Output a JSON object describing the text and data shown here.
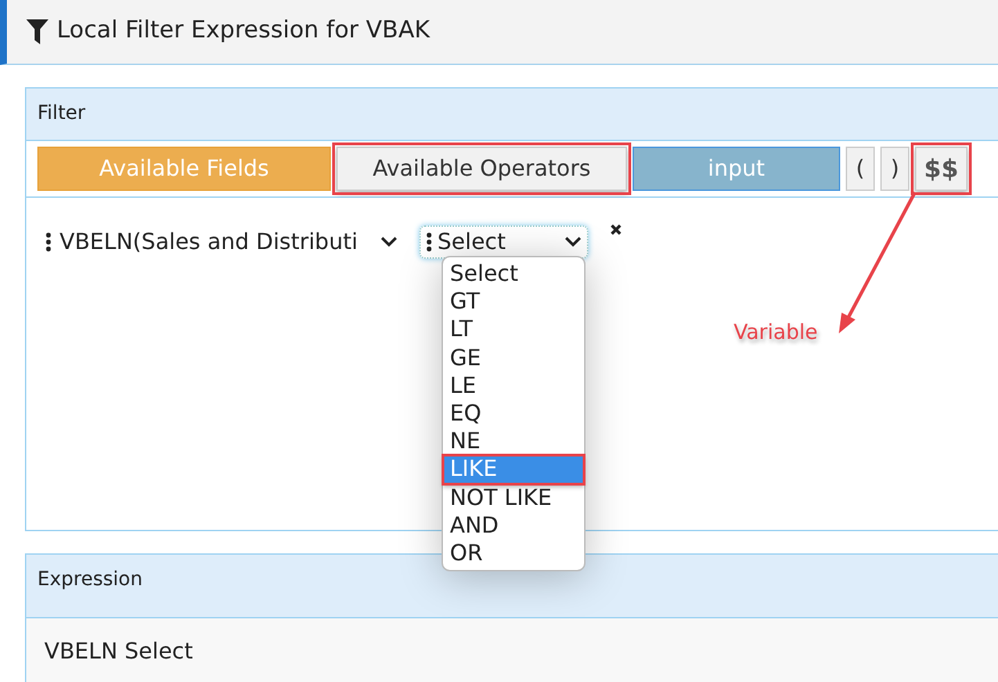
{
  "header": {
    "title": "Local Filter Expression for VBAK"
  },
  "filter": {
    "title": "Filter",
    "toolbar": [
      {
        "label": "Available Fields",
        "kind": "fields",
        "highlighted": false
      },
      {
        "label": "Available Operators",
        "kind": "operators",
        "highlighted": true
      },
      {
        "label": "input",
        "kind": "input",
        "highlighted": false
      },
      {
        "label": "(",
        "kind": "paren",
        "highlighted": false
      },
      {
        "label": ")",
        "kind": "paren",
        "highlighted": false
      },
      {
        "label": "$$",
        "kind": "variable",
        "highlighted": true
      }
    ],
    "condition": {
      "field": "VBELN(Sales and Distributi",
      "operator": "Select",
      "expanded": true,
      "options": [
        {
          "label": "Select",
          "selected": false,
          "highlighted": false
        },
        {
          "label": "GT",
          "selected": false,
          "highlighted": false
        },
        {
          "label": "LT",
          "selected": false,
          "highlighted": false
        },
        {
          "label": "GE",
          "selected": false,
          "highlighted": false
        },
        {
          "label": "LE",
          "selected": false,
          "highlighted": false
        },
        {
          "label": "EQ",
          "selected": false,
          "highlighted": false
        },
        {
          "label": "NE",
          "selected": false,
          "highlighted": false
        },
        {
          "label": "LIKE",
          "selected": true,
          "highlighted": true
        },
        {
          "label": "NOT LIKE",
          "selected": false,
          "highlighted": false
        },
        {
          "label": "AND",
          "selected": false,
          "highlighted": false
        },
        {
          "label": "OR",
          "selected": false,
          "highlighted": false
        }
      ]
    }
  },
  "callout": {
    "text": "Variable"
  },
  "expression": {
    "title": "Expression",
    "text": "VBELN Select"
  }
}
